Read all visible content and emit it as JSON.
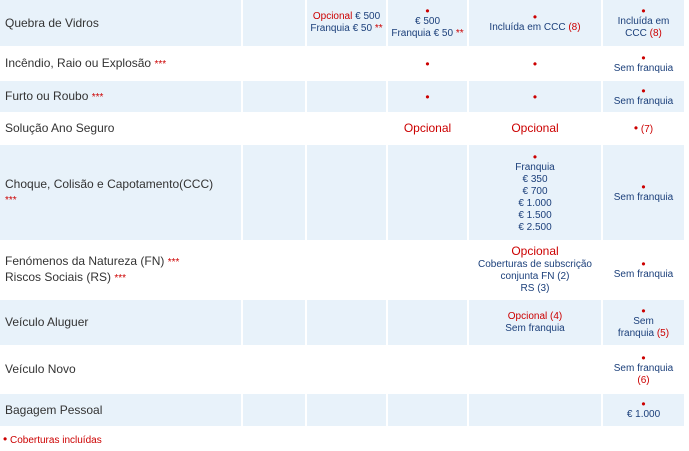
{
  "rows": [
    {
      "name": "Quebra de Vidros",
      "stars": "",
      "c2": {
        "opcional": "Opcional",
        "val": "€ 500",
        "fr": "Franquia € 50",
        "frstars": "**"
      },
      "c3": {
        "dot": "•",
        "val": "€ 500",
        "fr": "Franquia € 50",
        "frstars": "**"
      },
      "c4": {
        "dot": "•",
        "text": "Incluída em CCC",
        "ref": "(8)"
      },
      "c5": {
        "dot": "•",
        "line1": "Incluída em",
        "line2": "CCC",
        "ref": "(8)"
      }
    },
    {
      "name": "Incêndio, Raio ou Explosão",
      "stars": "***",
      "c3": {
        "dot": "•"
      },
      "c4": {
        "dot": "•"
      },
      "c5": {
        "dot": "•",
        "text": "Sem franquia"
      }
    },
    {
      "name": "Furto ou Roubo",
      "stars": "***",
      "c3": {
        "dot": "•"
      },
      "c4": {
        "dot": "•"
      },
      "c5": {
        "dot": "•",
        "text": "Sem franquia"
      }
    },
    {
      "name": "Solução Ano Seguro",
      "stars": "",
      "c3": {
        "text": "Opcional"
      },
      "c4": {
        "text": "Opcional"
      },
      "c5": {
        "dot": "•",
        "ref": "(7)"
      }
    },
    {
      "name": "Choque, Colisão e Capotamento(CCC)",
      "stars": "***",
      "c4": {
        "dot": "•",
        "label": "Franquia",
        "values": [
          "€ 350",
          "€ 700",
          "€ 1.000",
          "€ 1.500",
          "€ 2.500"
        ]
      },
      "c5": {
        "dot": "•",
        "text": "Sem franquia"
      }
    },
    {
      "name": "Fenómenos da Natureza (FN)",
      "stars": "***",
      "name2": "Riscos Sociais (RS)",
      "stars2": "***",
      "c4": {
        "opcional": "Opcional",
        "line1": "Coberturas de subscrição",
        "line2": "conjunta FN (2)",
        "line3": "RS (3)"
      },
      "c5": {
        "dot": "•",
        "text": "Sem franquia"
      }
    },
    {
      "name": "Veículo Aluguer",
      "stars": "",
      "c4": {
        "opcional": "Opcional (4)",
        "text": "Sem franquia"
      },
      "c5": {
        "dot": "•",
        "line1": "Sem",
        "line2": "franquia",
        "ref": "(5)"
      }
    },
    {
      "name": "Veículo Novo",
      "stars": "",
      "c5": {
        "dot": "•",
        "text": "Sem franquia",
        "ref": "(6)"
      }
    },
    {
      "name": "Bagagem Pessoal",
      "stars": "",
      "c5": {
        "dot": "•",
        "text": "€ 1.000"
      }
    }
  ],
  "footnote": {
    "dot": "•",
    "text": "Coberturas incluídas"
  },
  "colors": {
    "shade": "#e8f2fa",
    "red": "#cc0000",
    "blue": "#1b3f7a",
    "label": "#333333"
  }
}
